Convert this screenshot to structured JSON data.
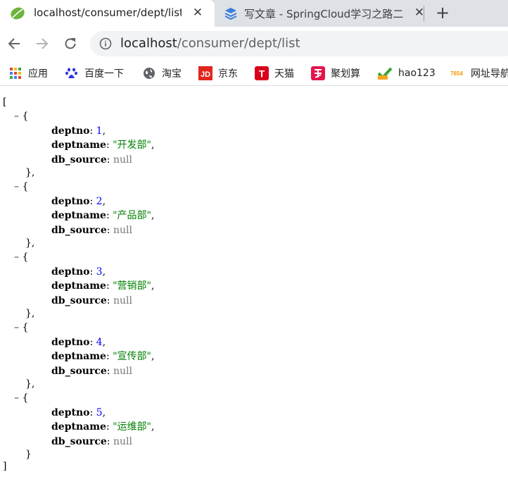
{
  "tabs": [
    {
      "title": "localhost/consumer/dept/list",
      "active": true,
      "favicon": "spring-leaf-icon"
    },
    {
      "title": "写文章 - SpringCloud学习之路二",
      "active": false,
      "favicon": "blog-icon"
    }
  ],
  "toolbar": {
    "url_host": "localhost",
    "url_path": "/consumer/dept/list"
  },
  "bookmarks": [
    {
      "label": "应用",
      "icon": "apps-grid-icon"
    },
    {
      "label": "百度一下",
      "icon": "baidu-paw-icon"
    },
    {
      "label": "淘宝",
      "icon": "globe-icon"
    },
    {
      "label": "京东",
      "icon": "jd-icon"
    },
    {
      "label": "天猫",
      "icon": "tmall-icon"
    },
    {
      "label": "聚划算",
      "icon": "juhuasuan-icon"
    },
    {
      "label": "hao123",
      "icon": "hao123-icon"
    },
    {
      "label": "网址导航",
      "icon": "7654-icon"
    }
  ],
  "json_view": {
    "open_bracket": "[",
    "close_bracket": "]",
    "toggle": "–",
    "open_brace": "{",
    "close_brace_comma": "},",
    "close_brace": "}",
    "records": [
      {
        "deptno": "1",
        "deptname": "\"开发部\"",
        "db_source": "null"
      },
      {
        "deptno": "2",
        "deptname": "\"产品部\"",
        "db_source": "null"
      },
      {
        "deptno": "3",
        "deptname": "\"营销部\"",
        "db_source": "null"
      },
      {
        "deptno": "4",
        "deptname": "\"宣传部\"",
        "db_source": "null"
      },
      {
        "deptno": "5",
        "deptname": "\"运维部\"",
        "db_source": "null"
      }
    ],
    "key_deptno": "deptno",
    "key_deptname": "deptname",
    "key_db_source": "db_source"
  }
}
